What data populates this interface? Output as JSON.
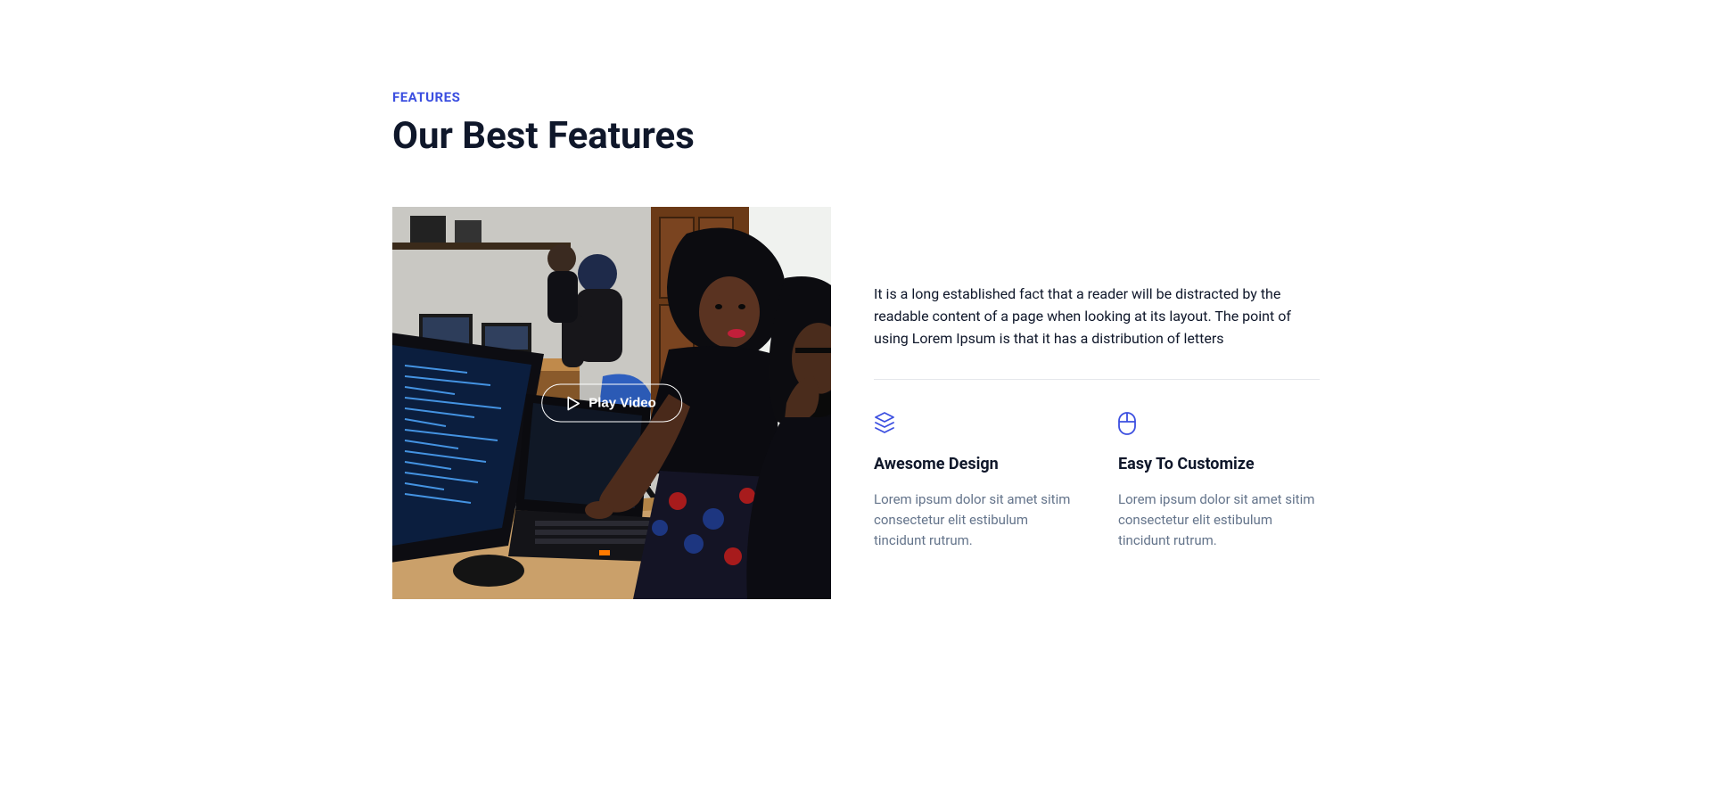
{
  "section": {
    "eyebrow": "FEATURES",
    "heading": "Our Best Features",
    "description": "It is a long established fact that a reader will be distracted by the readable content of a page when looking at its layout. The point of using Lorem Ipsum is that it has a distribution of letters",
    "play_button": "Play Video"
  },
  "features": [
    {
      "icon": "layers-icon",
      "title": "Awesome Design",
      "text": "Lorem ipsum dolor sit amet sitim consectetur elit estibulum tincidunt rutrum."
    },
    {
      "icon": "mouse-icon",
      "title": "Easy To Customize",
      "text": "Lorem ipsum dolor sit amet sitim consectetur elit estibulum tincidunt rutrum."
    }
  ],
  "colors": {
    "accent": "#3c4fe0",
    "heading": "#0f172a",
    "muted": "#64748b"
  }
}
